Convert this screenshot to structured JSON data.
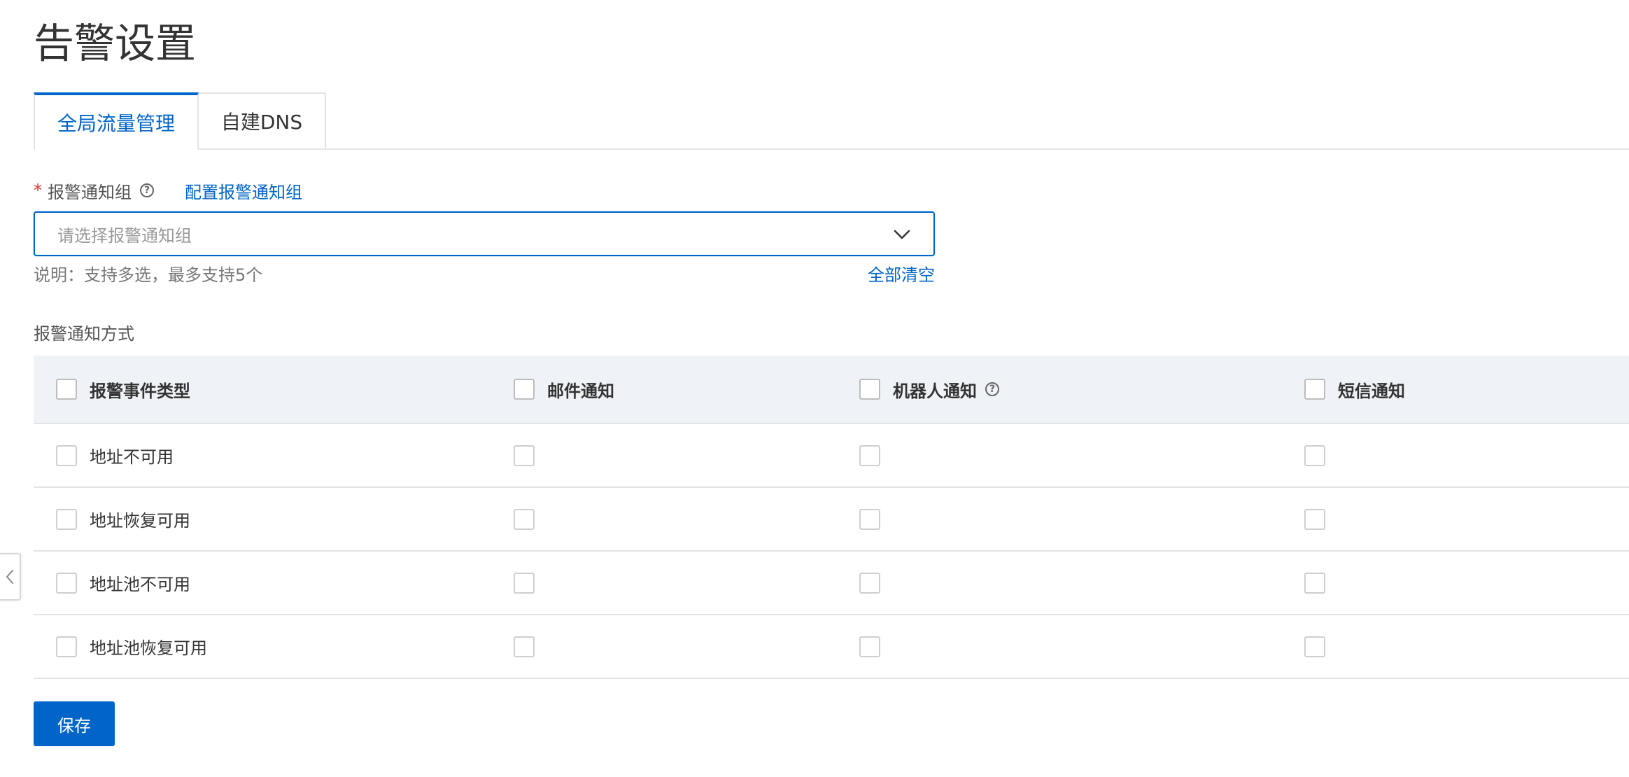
{
  "page": {
    "title": "告警设置"
  },
  "tabs": [
    {
      "label": "全局流量管理",
      "active": true
    },
    {
      "label": "自建DNS",
      "active": false
    }
  ],
  "notify_group": {
    "required_mark": "*",
    "label": "报警通知组",
    "config_link": "配置报警通知组",
    "placeholder": "请选择报警通知组",
    "hint": "说明：支持多选，最多支持5个",
    "clear_all": "全部清空"
  },
  "notify_method": {
    "section_label": "报警通知方式",
    "columns": {
      "event_type": "报警事件类型",
      "email": "邮件通知",
      "robot": "机器人通知",
      "sms": "短信通知"
    },
    "rows": [
      {
        "label": "地址不可用"
      },
      {
        "label": "地址恢复可用"
      },
      {
        "label": "地址池不可用"
      },
      {
        "label": "地址池恢复可用"
      }
    ]
  },
  "actions": {
    "save_label": "保存"
  },
  "colors": {
    "primary": "#0064c8",
    "header_bg": "#eff3f8",
    "required": "#d93026"
  },
  "icons": {
    "help": "question-circle-icon",
    "select_arrow": "chevron-down-icon",
    "side_handle": "chevron-left-icon"
  }
}
